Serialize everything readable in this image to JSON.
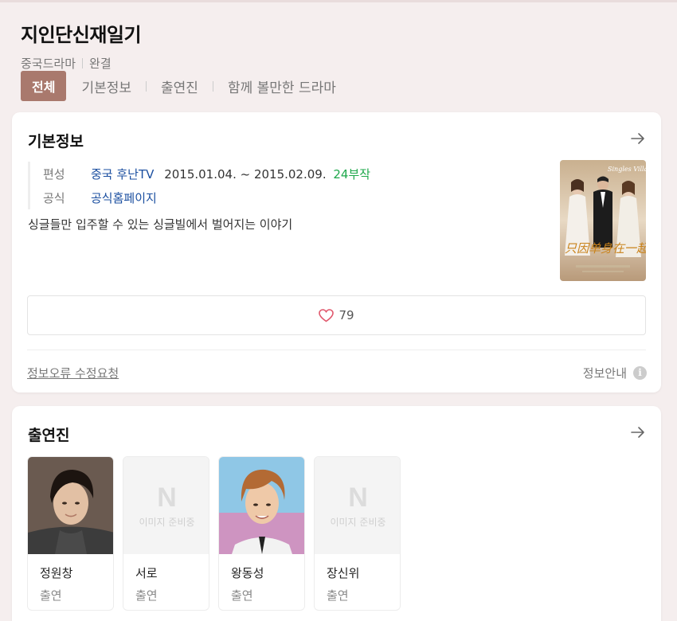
{
  "header": {
    "title": "지인단신재일기",
    "genre": "중국드라마",
    "status": "완결"
  },
  "tabs": [
    {
      "label": "전체",
      "active": true
    },
    {
      "label": "기본정보",
      "active": false
    },
    {
      "label": "출연진",
      "active": false
    },
    {
      "label": "함께 볼만한 드라마",
      "active": false
    }
  ],
  "basic_info": {
    "heading": "기본정보",
    "rows": {
      "broadcast": {
        "key": "편성",
        "channel": "중국 후난TV",
        "dates": "2015.01.04. ~ 2015.02.09.",
        "episodes": "24부작"
      },
      "official": {
        "key": "공식",
        "value": "공식홈페이지"
      }
    },
    "description": "싱글들만 입주할 수 있는 싱글빌에서 벌어지는 이야기",
    "poster": {
      "title_en": "Singles Villa",
      "title_cn": "只因单身在一起"
    },
    "likes": "79",
    "report_link": "정보오류 수정요청",
    "info_guide": "정보안내"
  },
  "cast": {
    "heading": "출연진",
    "placeholder_text": "이미지 준비중",
    "members": [
      {
        "name": "정원창",
        "role": "출연",
        "has_photo": true
      },
      {
        "name": "서로",
        "role": "출연",
        "has_photo": false
      },
      {
        "name": "왕동성",
        "role": "출연",
        "has_photo": true
      },
      {
        "name": "장신위",
        "role": "출연",
        "has_photo": false
      }
    ]
  },
  "colors": {
    "accent": "#a9796d",
    "link": "#1b4fa0",
    "episodes": "#1ea84b",
    "background": "#f5eeee"
  }
}
